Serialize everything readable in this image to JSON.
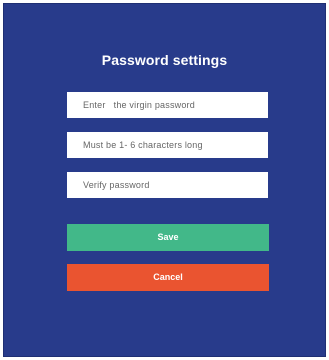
{
  "dialog": {
    "title": "Password settings",
    "fields": [
      {
        "name": "original-password-field",
        "placeholder": "Enter   the virgin password"
      },
      {
        "name": "new-password-field",
        "placeholder": "Must be 1- 6 characters long"
      },
      {
        "name": "verify-password-field",
        "placeholder": "Verify password"
      }
    ],
    "buttons": {
      "save_label": "Save",
      "cancel_label": "Cancel"
    }
  },
  "colors": {
    "background": "#283b8b",
    "save": "#42b889",
    "cancel": "#ea5430",
    "field": "#ffffff"
  }
}
